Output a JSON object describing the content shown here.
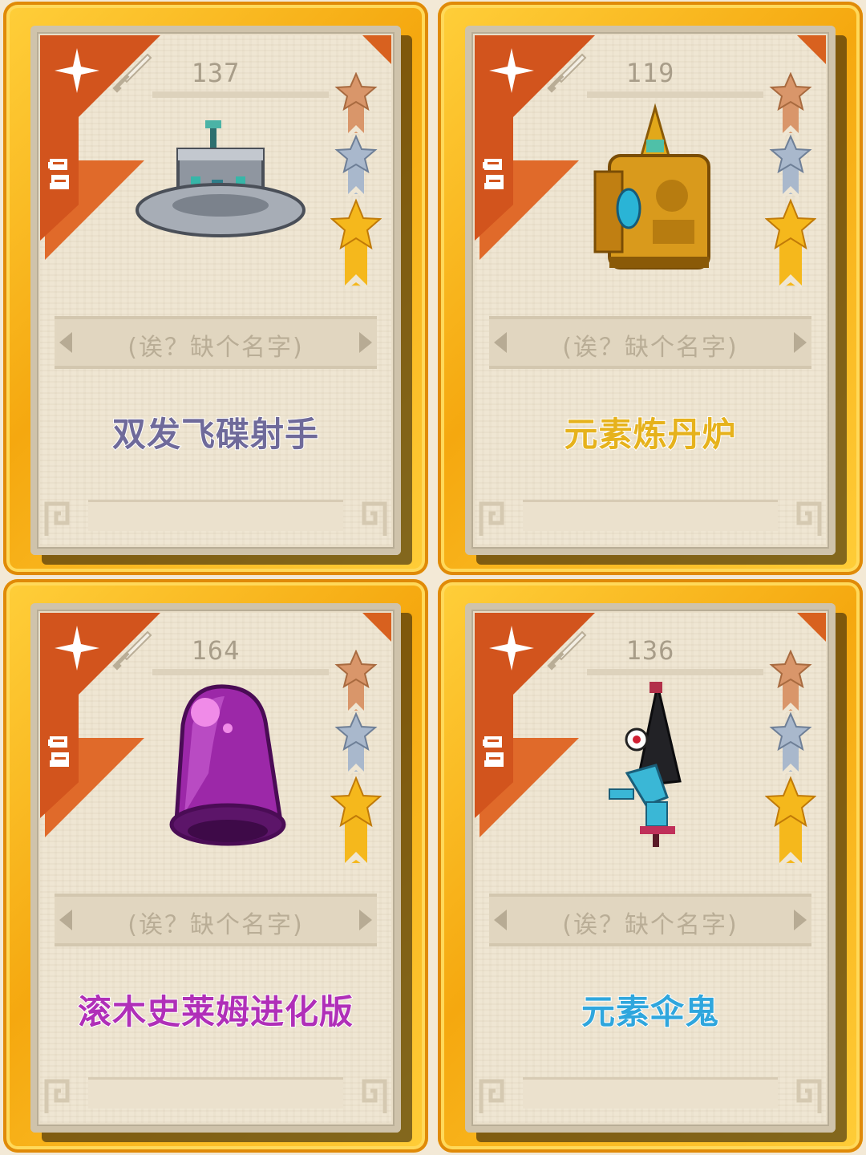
{
  "placeholder_name": "(诶？缺个名字)",
  "cards": [
    {
      "power": "137",
      "title": "双发飞碟射手",
      "title_color": "#6f6a9a",
      "item": "ufo-hat"
    },
    {
      "power": "119",
      "title": "元素炼丹炉",
      "title_color": "#e6b21c",
      "item": "golden-furnace"
    },
    {
      "power": "164",
      "title": "滚木史莱姆进化版",
      "title_color": "#b02fb8",
      "item": "purple-slime-bell"
    },
    {
      "power": "136",
      "title": "元素伞鬼",
      "title_color": "#2fa6dd",
      "item": "umbrella-ghost"
    }
  ],
  "colors": {
    "frame_gold": "#f5a80f",
    "corner_orange": "#d2541d",
    "paper": "#efe6d3",
    "bronze_star": "#d9966a",
    "silver_star": "#a9b8cc",
    "gold_star": "#f5b81c"
  }
}
